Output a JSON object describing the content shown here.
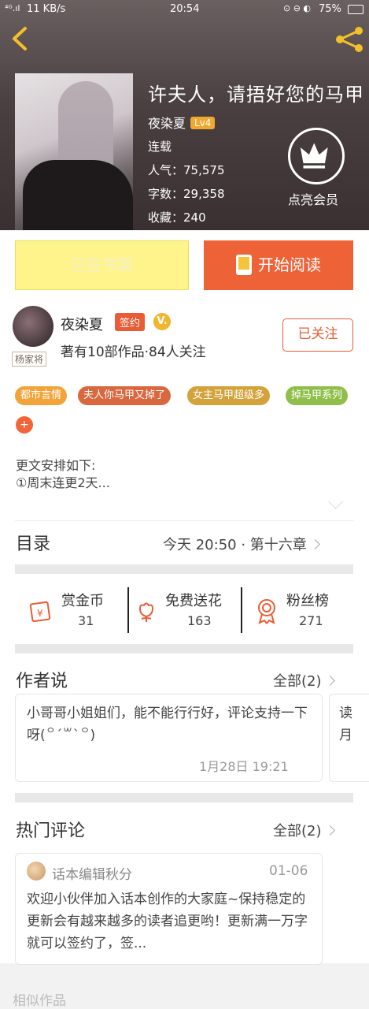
{
  "status_bar": {
    "network": "⁴ᴳ.ıl",
    "speed": "11 KB/s",
    "time": "20:54",
    "battery": "75%"
  },
  "book": {
    "title": "许夫人，请捂好您的马甲",
    "author": "夜染夏",
    "level": "Lv4",
    "status": "连载",
    "popularity": "人气：75,575",
    "word_count": "字数：29,358",
    "favorites": "收藏：240"
  },
  "vip": {
    "label": "点亮会员",
    "icon": "crown-icon"
  },
  "buttons": {
    "shelf": "已在书架",
    "read": "开始阅读"
  },
  "author": {
    "name": "夜染夏",
    "sign_badge": "签约",
    "verified_badge": "V.",
    "avatar_tag": "杨家将",
    "stats": "著有10部作品·84人关注",
    "follow": "已关注"
  },
  "tags": [
    {
      "label": "都市言情",
      "color": "#f2a43a"
    },
    {
      "label": "夫人你马甲又掉了",
      "color": "#d9683f"
    },
    {
      "label": "女主马甲超级多",
      "color": "#d4a23a"
    },
    {
      "label": "掉马甲系列",
      "color": "#8fbf4a"
    }
  ],
  "add_tag": "+",
  "description": {
    "line1": "更文安排如下:",
    "line2": "①周末连更2天..."
  },
  "toc": {
    "title": "目录",
    "latest": "今天 20:50 · 第十六章"
  },
  "stats": [
    {
      "label": "赏金币",
      "value": "31",
      "icon": "reward-coin-icon"
    },
    {
      "label": "免费送花",
      "value": "163",
      "icon": "flower-icon"
    },
    {
      "label": "粉丝榜",
      "value": "271",
      "icon": "medal-icon"
    }
  ],
  "author_says": {
    "title": "作者说",
    "all": "全部(2)",
    "text": "小哥哥小姐姐们，能不能行行好，评论支持一下呀(꒪ˊ꒳ˋ꒪)",
    "time": "1月28日  19:21",
    "next_preview": "读月"
  },
  "hot_comments": {
    "title": "热门评论",
    "all": "全部(2)",
    "user": "话本编辑秋分",
    "date": "01-06",
    "text": "欢迎小伙伴加入话本创作的大家庭~保持稳定的更新会有越来越多的读者追更哟！更新满一万字就可以签约了，签..."
  },
  "similar_title": "相似作品"
}
